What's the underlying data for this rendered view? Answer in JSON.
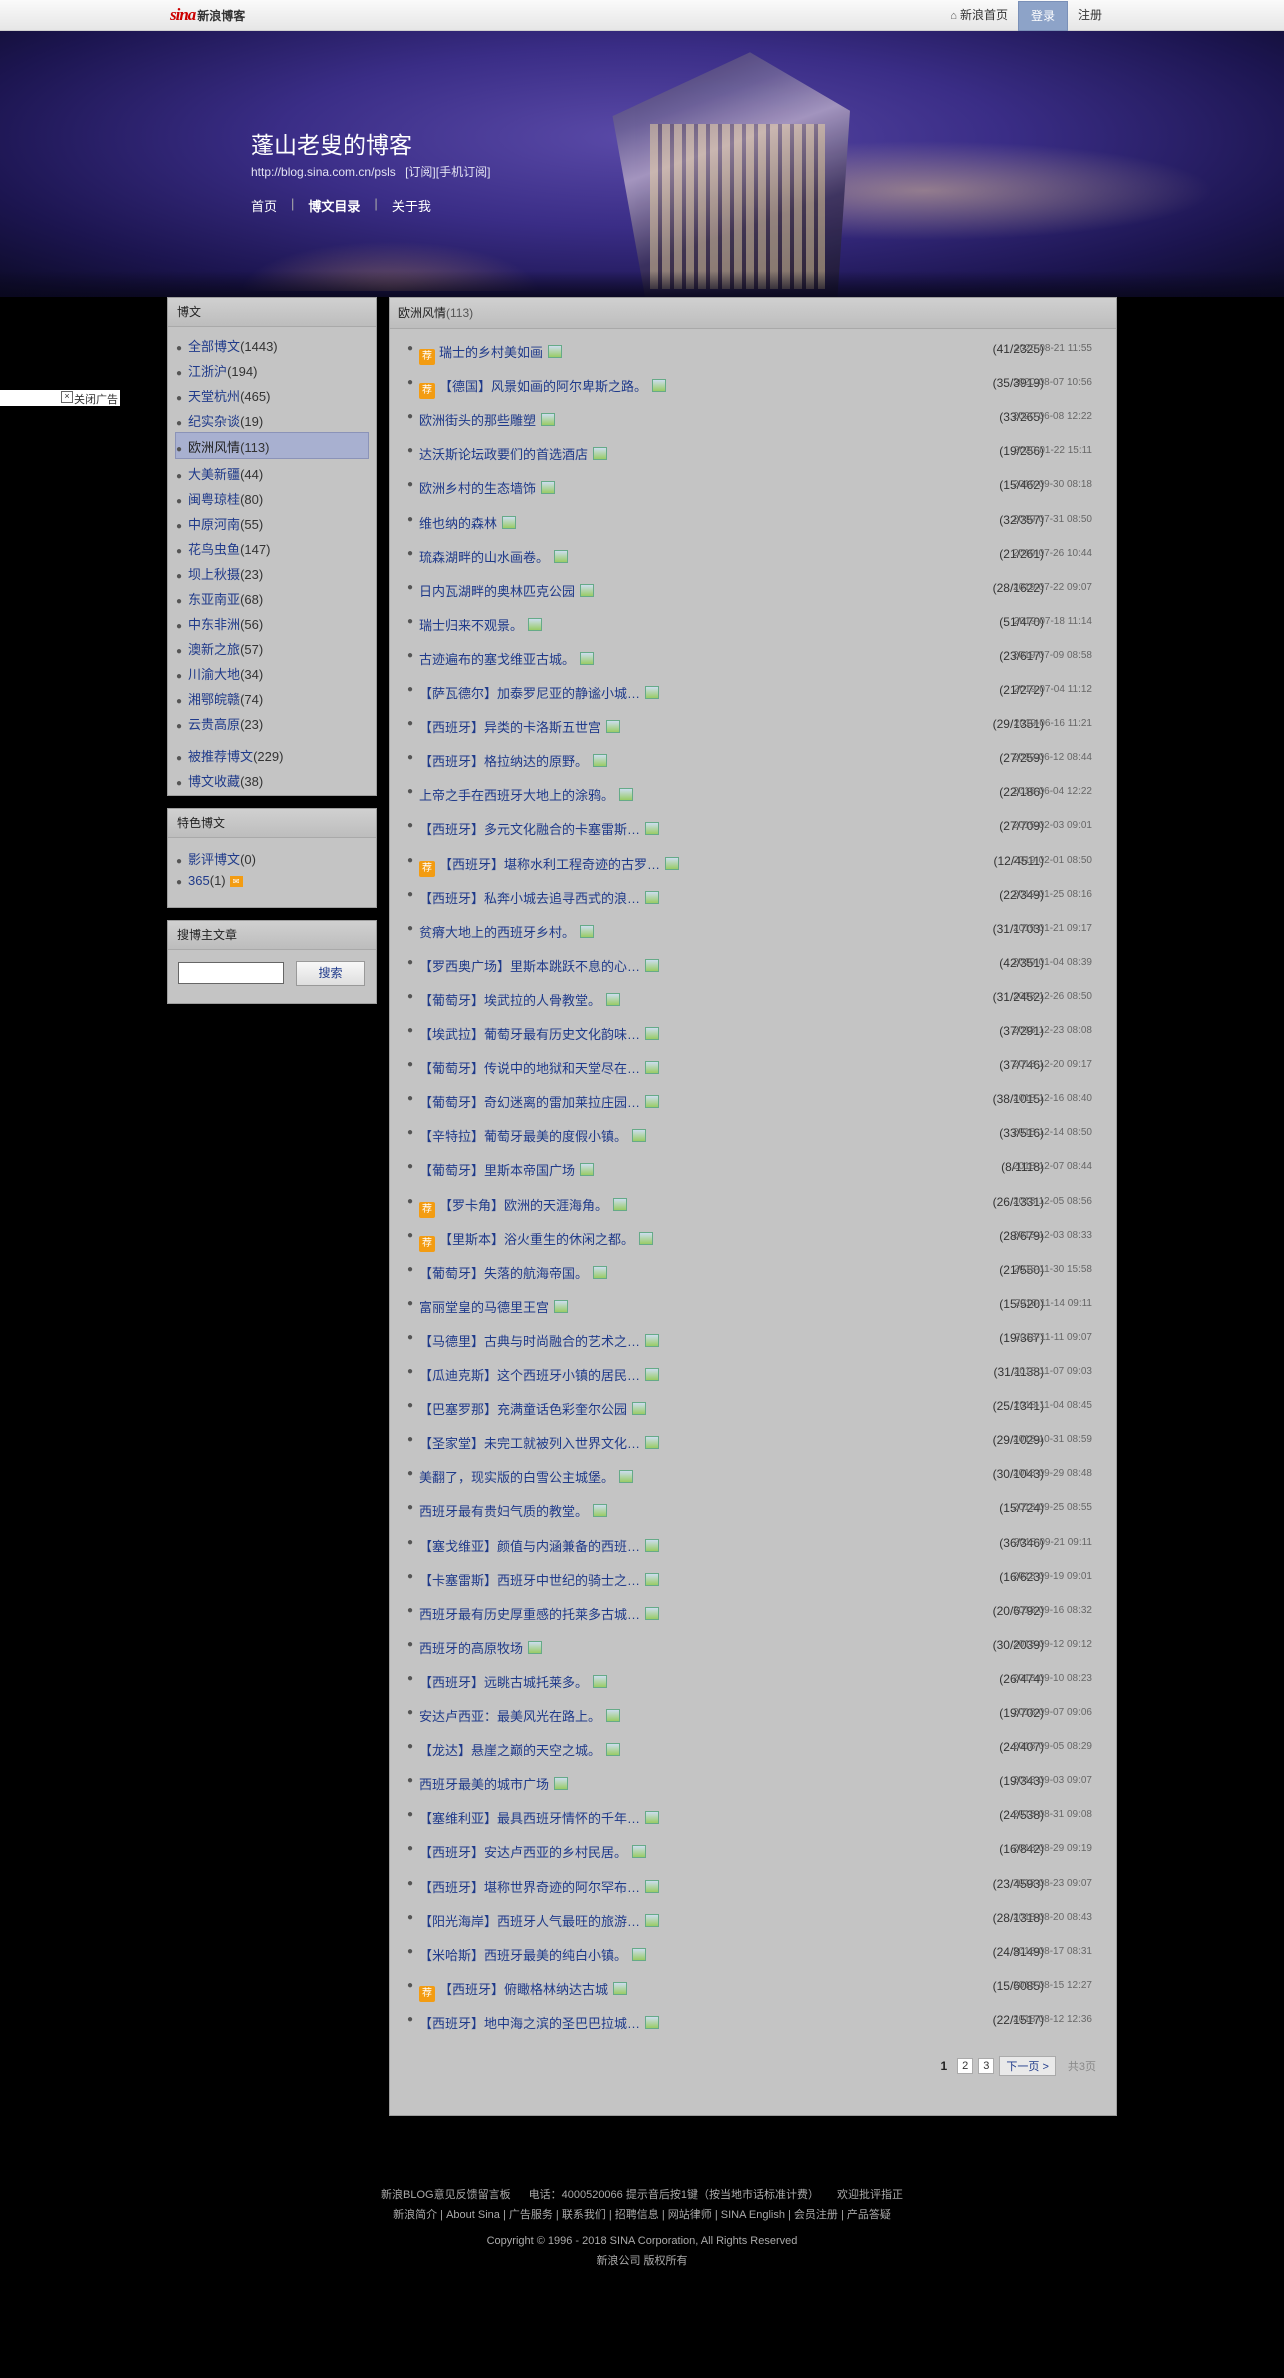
{
  "topbar": {
    "logo_sina": "sina",
    "logo_blog": "新浪博客",
    "home_link": "新浪首页",
    "login": "登录",
    "register": "注册"
  },
  "header": {
    "title": "蓬山老叟的博客",
    "url": "http://blog.sina.com.cn/psls",
    "subscribe": "[订阅]",
    "mobile_subscribe": "[手机订阅]",
    "nav": [
      "首页",
      "博文目录",
      "关于我"
    ],
    "nav_active": "博文目录"
  },
  "close_ad": "关闭广告",
  "sidebar": {
    "articles_head": "博文",
    "categories": [
      {
        "name": "全部博文",
        "count": "(1443)"
      },
      {
        "name": "江浙沪",
        "count": "(194)"
      },
      {
        "name": "天堂杭州",
        "count": "(465)"
      },
      {
        "name": "纪实杂谈",
        "count": "(19)"
      },
      {
        "name": "欧洲风情",
        "count": "(113)",
        "selected": true
      },
      {
        "name": "大美新疆",
        "count": "(44)"
      },
      {
        "name": "闽粤琼桂",
        "count": "(80)"
      },
      {
        "name": "中原河南",
        "count": "(55)"
      },
      {
        "name": "花鸟虫鱼",
        "count": "(147)"
      },
      {
        "name": "坝上秋摄",
        "count": "(23)"
      },
      {
        "name": "东亚南亚",
        "count": "(68)"
      },
      {
        "name": "中东非洲",
        "count": "(56)"
      },
      {
        "name": "澳新之旅",
        "count": "(57)"
      },
      {
        "name": "川渝大地",
        "count": "(34)"
      },
      {
        "name": "湘鄂皖赣",
        "count": "(74)"
      },
      {
        "name": "云贵高原",
        "count": "(23)"
      }
    ],
    "extra": [
      {
        "name": "被推荐博文",
        "count": "(229)"
      },
      {
        "name": "博文收藏",
        "count": "(38)"
      }
    ],
    "featured_head": "特色博文",
    "featured": [
      {
        "name": "影评博文",
        "count": "(0)"
      },
      {
        "name": "365",
        "count": "(1)"
      }
    ],
    "search_head": "搜博主文章",
    "search_button": "搜索"
  },
  "main": {
    "category": "欧洲风情",
    "count": "(113)",
    "rec_badge": "荐",
    "posts": [
      {
        "rec": true,
        "title": "瑞士的乡村美如画",
        "counts": "(41/2325)",
        "time": "2020-08-21 11:55"
      },
      {
        "rec": true,
        "title": "【德国】风景如画的阿尔卑斯之路。",
        "counts": "(35/3919)",
        "time": "2020-08-07 10:56"
      },
      {
        "rec": false,
        "title": "欧洲街头的那些雕塑",
        "counts": "(33/265)",
        "time": "2020-06-08 12:22"
      },
      {
        "rec": false,
        "title": "达沃斯论坛政要们的首选酒店",
        "counts": "(19/256)",
        "time": "2020-01-22 15:11"
      },
      {
        "rec": false,
        "title": "欧洲乡村的生态墙饰",
        "counts": "(15/462)",
        "time": "2019-09-30 08:18"
      },
      {
        "rec": false,
        "title": "维也纳的森林",
        "counts": "(32/357)",
        "time": "2019-07-31 08:50"
      },
      {
        "rec": false,
        "title": "琉森湖畔的山水画卷。",
        "counts": "(21/261)",
        "time": "2019-07-26 10:44"
      },
      {
        "rec": false,
        "title": "日内瓦湖畔的奥林匹克公园",
        "counts": "(28/1622)",
        "time": "2019-07-22 09:07"
      },
      {
        "rec": false,
        "title": "瑞士归来不观景。",
        "counts": "(51/470)",
        "time": "2019-07-18 11:14"
      },
      {
        "rec": false,
        "title": "古迹遍布的塞戈维亚古城。",
        "counts": "(23/617)",
        "time": "2019-07-09 08:58"
      },
      {
        "rec": false,
        "title": "【萨瓦德尔】加泰罗尼亚的静谧小城…",
        "counts": "(21/272)",
        "time": "2019-07-04 11:12"
      },
      {
        "rec": false,
        "title": "【西班牙】异类的卡洛斯五世宫",
        "counts": "(29/1351)",
        "time": "2019-06-16 11:21"
      },
      {
        "rec": false,
        "title": "【西班牙】格拉纳达的原野。",
        "counts": "(27/259)",
        "time": "2019-06-12 08:44"
      },
      {
        "rec": false,
        "title": "上帝之手在西班牙大地上的涂鸦。",
        "counts": "(22/186)",
        "time": "2019-06-04 12:22"
      },
      {
        "rec": false,
        "title": "【西班牙】多元文化融合的卡塞雷斯…",
        "counts": "(27/709)",
        "time": "2019-02-03 09:01"
      },
      {
        "rec": true,
        "title": "【西班牙】堪称水利工程奇迹的古罗…",
        "counts": "(12/4511)",
        "time": "2019-02-01 08:50"
      },
      {
        "rec": false,
        "title": "【西班牙】私奔小城去追寻西式的浪…",
        "counts": "(22/349)",
        "time": "2019-01-25 08:16"
      },
      {
        "rec": false,
        "title": "贫瘠大地上的西班牙乡村。",
        "counts": "(31/1703)",
        "time": "2019-01-21 09:17"
      },
      {
        "rec": false,
        "title": "【罗西奥广场】里斯本跳跃不息的心…",
        "counts": "(42/351)",
        "time": "2019-01-04 08:39"
      },
      {
        "rec": false,
        "title": "【葡萄牙】埃武拉的人骨教堂。",
        "counts": "(31/2452)",
        "time": "2018-12-26 08:50"
      },
      {
        "rec": false,
        "title": "【埃武拉】葡萄牙最有历史文化韵味…",
        "counts": "(37/291)",
        "time": "2018-12-23 08:08"
      },
      {
        "rec": false,
        "title": "【葡萄牙】传说中的地狱和天堂尽在…",
        "counts": "(37/746)",
        "time": "2018-12-20 09:17"
      },
      {
        "rec": false,
        "title": "【葡萄牙】奇幻迷离的雷加莱拉庄园…",
        "counts": "(38/1015)",
        "time": "2018-12-16 08:40"
      },
      {
        "rec": false,
        "title": "【辛特拉】葡萄牙最美的度假小镇。",
        "counts": "(33/516)",
        "time": "2018-12-14 08:50"
      },
      {
        "rec": false,
        "title": "【葡萄牙】里斯本帝国广场",
        "counts": "(8/1118)",
        "time": "2018-12-07 08:44"
      },
      {
        "rec": true,
        "title": "【罗卡角】欧洲的天涯海角。",
        "counts": "(26/1331)",
        "time": "2018-12-05 08:56"
      },
      {
        "rec": true,
        "title": "【里斯本】浴火重生的休闲之都。",
        "counts": "(28/679)",
        "time": "2018-12-03 08:33"
      },
      {
        "rec": false,
        "title": "【葡萄牙】失落的航海帝国。",
        "counts": "(21/550)",
        "time": "2018-11-30 15:58"
      },
      {
        "rec": false,
        "title": "富丽堂皇的马德里王宫",
        "counts": "(15/520)",
        "time": "2018-11-14 09:11"
      },
      {
        "rec": false,
        "title": "【马德里】古典与时尚融合的艺术之…",
        "counts": "(19/367)",
        "time": "2018-11-11 09:07"
      },
      {
        "rec": false,
        "title": "【瓜迪克斯】这个西班牙小镇的居民…",
        "counts": "(31/1138)",
        "time": "2018-11-07 09:03"
      },
      {
        "rec": false,
        "title": "【巴塞罗那】充满童话色彩奎尔公园",
        "counts": "(25/1341)",
        "time": "2018-11-04 08:45"
      },
      {
        "rec": false,
        "title": "【圣家堂】未完工就被列入世界文化…",
        "counts": "(29/1029)",
        "time": "2018-10-31 08:59"
      },
      {
        "rec": false,
        "title": "美翻了，现实版的白雪公主城堡。",
        "counts": "(30/1043)",
        "time": "2018-09-29 08:48"
      },
      {
        "rec": false,
        "title": "西班牙最有贵妇气质的教堂。",
        "counts": "(15/724)",
        "time": "2018-09-25 08:55"
      },
      {
        "rec": false,
        "title": "【塞戈维亚】颜值与内涵兼备的西班…",
        "counts": "(36/346)",
        "time": "2018-09-21 09:11"
      },
      {
        "rec": false,
        "title": "【卡塞雷斯】西班牙中世纪的骑士之…",
        "counts": "(16/623)",
        "time": "2018-09-19 09:01"
      },
      {
        "rec": false,
        "title": "西班牙最有历史厚重感的托莱多古城…",
        "counts": "(20/6792)",
        "time": "2018-09-16 08:32"
      },
      {
        "rec": false,
        "title": "西班牙的高原牧场",
        "counts": "(30/2039)",
        "time": "2018-09-12 09:12"
      },
      {
        "rec": false,
        "title": "【西班牙】远眺古城托莱多。",
        "counts": "(26/474)",
        "time": "2018-09-10 08:23"
      },
      {
        "rec": false,
        "title": "安达卢西亚：最美风光在路上。",
        "counts": "(19/702)",
        "time": "2018-09-07 09:06"
      },
      {
        "rec": false,
        "title": "【龙达】悬崖之巅的天空之城。",
        "counts": "(24/407)",
        "time": "2018-09-05 08:29"
      },
      {
        "rec": false,
        "title": "西班牙最美的城市广场",
        "counts": "(19/343)",
        "time": "2018-09-03 09:07"
      },
      {
        "rec": false,
        "title": "【塞维利亚】最具西班牙情怀的千年…",
        "counts": "(24/538)",
        "time": "2018-08-31 09:08"
      },
      {
        "rec": false,
        "title": "【西班牙】安达卢西亚的乡村民居。",
        "counts": "(16/842)",
        "time": "2018-08-29 09:19"
      },
      {
        "rec": false,
        "title": "【西班牙】堪称世界奇迹的阿尔罕布…",
        "counts": "(23/4593)",
        "time": "2018-08-23 09:07"
      },
      {
        "rec": false,
        "title": "【阳光海岸】西班牙人气最旺的旅游…",
        "counts": "(28/1318)",
        "time": "2018-08-20 08:43"
      },
      {
        "rec": false,
        "title": "【米哈斯】西班牙最美的纯白小镇。",
        "counts": "(24/8149)",
        "time": "2018-08-17 08:31"
      },
      {
        "rec": true,
        "title": "【西班牙】俯瞰格林纳达古城",
        "counts": "(15/6085)",
        "time": "2018-08-15 12:27"
      },
      {
        "rec": false,
        "title": "【西班牙】地中海之滨的圣巴巴拉城…",
        "counts": "(22/1517)",
        "time": "2018-08-12 12:36"
      }
    ],
    "pager": {
      "current": "1",
      "pages": [
        "2",
        "3"
      ],
      "next": "下一页 >",
      "total": "共3页"
    }
  },
  "footer": {
    "line1a": "新浪BLOG意见反馈留言板",
    "line1b": "电话：4000520066 提示音后按1键（按当地市话标准计费）",
    "line1c": "欢迎批评指正",
    "line2": "新浪简介 | About Sina | 广告服务 | 联系我们 | 招聘信息 | 网站律师 | SINA English | 会员注册 | 产品答疑",
    "line3": "Copyright © 1996 - 2018 SINA Corporation, All Rights Reserved",
    "line4": "新浪公司 版权所有"
  }
}
